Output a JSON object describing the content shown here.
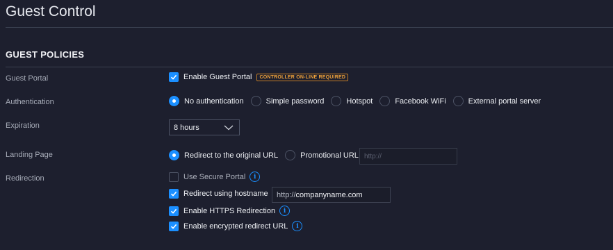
{
  "page": {
    "title": "Guest Control"
  },
  "section": {
    "title": "GUEST POLICIES"
  },
  "rows": {
    "guest_portal": {
      "label": "Guest Portal",
      "checkbox_label": "Enable Guest Portal",
      "checked": true,
      "badge": "CONTROLLER ON-LINE REQUIRED"
    },
    "authentication": {
      "label": "Authentication",
      "options": [
        "No authentication",
        "Simple password",
        "Hotspot",
        "Facebook WiFi",
        "External portal server"
      ],
      "selected": "No authentication"
    },
    "expiration": {
      "label": "Expiration",
      "value": "8 hours"
    },
    "landing_page": {
      "label": "Landing Page",
      "options": [
        "Redirect to the original URL",
        "Promotional URL"
      ],
      "selected": "Redirect to the original URL",
      "url_placeholder": "http://"
    },
    "redirection": {
      "label": "Redirection",
      "secure_portal": {
        "label": "Use Secure Portal",
        "checked": false
      },
      "hostname": {
        "label": "Redirect using hostname",
        "checked": true,
        "prefix": "http://",
        "value": "companyname.com"
      },
      "https": {
        "label": "Enable HTTPS Redirection",
        "checked": true
      },
      "encrypted": {
        "label": "Enable encrypted redirect URL",
        "checked": true
      }
    }
  },
  "icons": {
    "info": "i"
  },
  "colors": {
    "accent": "#1b8fff",
    "badge": "#f0a23a",
    "background": "#1d1f2e"
  }
}
